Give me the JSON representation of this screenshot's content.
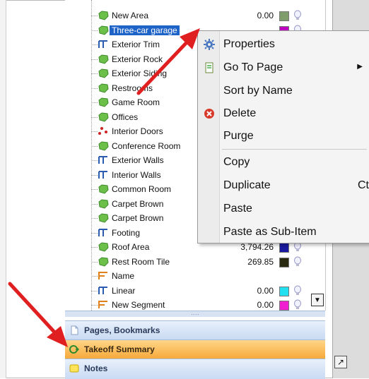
{
  "tree": {
    "items": [
      {
        "label": "New Area",
        "value": "0.00",
        "icon": "area-icon",
        "color": "#7f9c6c"
      },
      {
        "label": "Three-car garage",
        "value": "",
        "icon": "area-icon",
        "color": "#c000c0",
        "selected": true
      },
      {
        "label": "Exterior Trim",
        "value": "",
        "icon": "linear-icon",
        "color": ""
      },
      {
        "label": "Exterior Rock",
        "value": "",
        "icon": "area-icon",
        "color": ""
      },
      {
        "label": "Exterior Siding",
        "value": "",
        "icon": "area-icon",
        "color": ""
      },
      {
        "label": "Restrooms",
        "value": "",
        "icon": "area-icon",
        "color": ""
      },
      {
        "label": "Game Room",
        "value": "",
        "icon": "area-icon",
        "color": ""
      },
      {
        "label": "Offices",
        "value": "",
        "icon": "area-icon",
        "color": ""
      },
      {
        "label": "Interior Doors",
        "value": "",
        "icon": "count-icon",
        "color": ""
      },
      {
        "label": "Conference Room",
        "value": "",
        "icon": "area-icon",
        "color": ""
      },
      {
        "label": "Exterior Walls",
        "value": "",
        "icon": "linear-icon",
        "color": ""
      },
      {
        "label": "Interior Walls",
        "value": "",
        "icon": "linear-icon",
        "color": ""
      },
      {
        "label": "Common Room",
        "value": "",
        "icon": "area-icon",
        "color": ""
      },
      {
        "label": "Carpet Brown",
        "value": "",
        "icon": "area-icon",
        "color": ""
      },
      {
        "label": "Carpet Brown",
        "value": "",
        "icon": "area-icon",
        "color": ""
      },
      {
        "label": "Footing",
        "value": "",
        "icon": "linear-icon",
        "color": ""
      },
      {
        "label": "Roof Area",
        "value": "3,794.26",
        "icon": "area-icon",
        "color": "#1a1aa0"
      },
      {
        "label": "Rest Room Tile",
        "value": "269.85",
        "icon": "area-icon",
        "color": "#2a2a10"
      },
      {
        "label": "Name",
        "value": "",
        "icon": "segment-icon",
        "color": ""
      },
      {
        "label": "Linear",
        "value": "0.00",
        "icon": "linear-icon",
        "color": "#22e0f0"
      },
      {
        "label": "New Segment",
        "value": "0.00",
        "icon": "segment-icon",
        "color": "#f020d0"
      }
    ]
  },
  "context_menu": {
    "items": [
      {
        "label": "Properties",
        "icon": "gear-icon"
      },
      {
        "label": "Go To Page",
        "icon": "page-icon",
        "submenu": true
      },
      {
        "label": "Sort by Name",
        "icon": ""
      },
      {
        "label": "Delete",
        "icon": "delete-icon"
      },
      {
        "label": "Purge",
        "icon": ""
      },
      {
        "label": "Copy",
        "icon": ""
      },
      {
        "label": "Duplicate",
        "icon": "",
        "shortcut": "Ctr"
      },
      {
        "label": "Paste",
        "icon": ""
      },
      {
        "label": "Paste as Sub-Item",
        "icon": ""
      }
    ]
  },
  "bottom_panels": {
    "pages_label": "Pages, Bookmarks",
    "takeoff_label": "Takeoff Summary",
    "notes_label": "Notes"
  },
  "splitter_grip": ".....",
  "scroll_down_glyph": "▼",
  "resize_glyph": "↗",
  "submenu_glyph": "▶",
  "colors": {
    "arrow": "#e02020",
    "selection": "#1e63c8",
    "takeoff_active": "#f7a93a",
    "area_green": "#6cc04a"
  }
}
